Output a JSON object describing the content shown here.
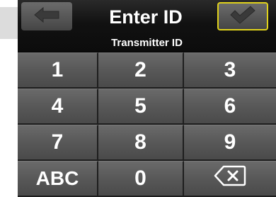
{
  "header": {
    "title": "Enter ID",
    "subtitle": "Transmitter ID"
  },
  "keypad": {
    "keys": [
      "1",
      "2",
      "3",
      "4",
      "5",
      "6",
      "7",
      "8",
      "9",
      "ABC",
      "0"
    ]
  },
  "icons": {
    "back": "arrow-left-icon",
    "confirm": "checkmark-icon",
    "delete": "backspace-icon"
  },
  "colors": {
    "confirm_highlight": "#e0d21b",
    "key_face": "#5e5e5e"
  }
}
